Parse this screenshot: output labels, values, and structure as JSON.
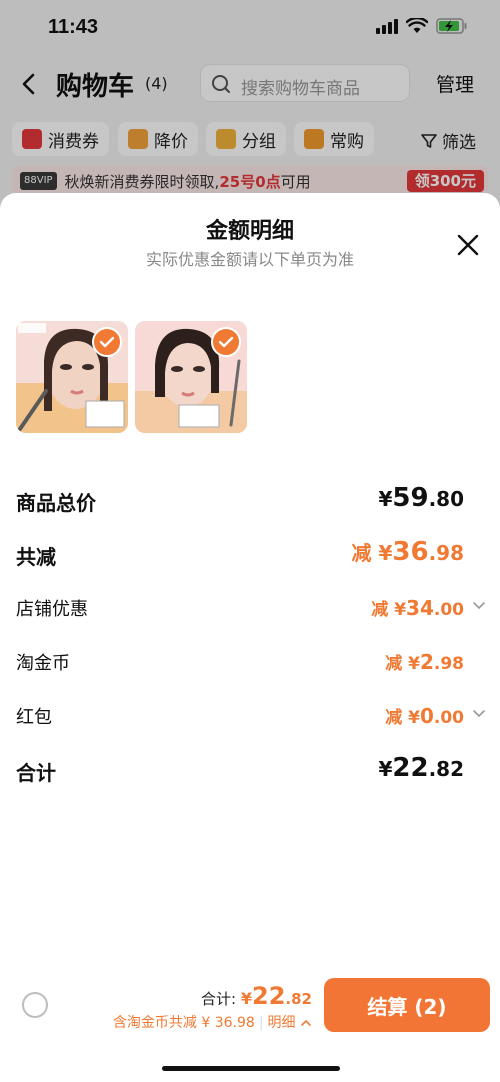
{
  "status": {
    "time": "11:43"
  },
  "header": {
    "title": "购物车",
    "count": "(4)",
    "search_placeholder": "搜索购物车商品",
    "manage": "管理"
  },
  "chips": [
    {
      "label": "消费券",
      "icon": "coupon-icon"
    },
    {
      "label": "降价",
      "icon": "price-drop-icon"
    },
    {
      "label": "分组",
      "icon": "folder-icon"
    },
    {
      "label": "常购",
      "icon": "cart-icon"
    }
  ],
  "filter_label": "筛选",
  "promo": {
    "vip": "88VIP",
    "text_prefix": "秋焕新消费券限时领取,",
    "text_highlight": "25号0点",
    "text_suffix": "可用",
    "button": "领300元"
  },
  "sheet": {
    "title": "金额明细",
    "subtitle": "实际优惠金额请以下单页为准",
    "rows": [
      {
        "label": "商品总价",
        "prefix": "",
        "yen": "¥",
        "int": "59",
        "dec": ".80"
      },
      {
        "label": "共减",
        "prefix": "减",
        "yen": "¥",
        "int": "36",
        "dec": ".98"
      },
      {
        "label": "店铺优惠",
        "prefix": "减",
        "yen": "¥",
        "int": "34",
        "dec": ".00"
      },
      {
        "label": "淘金币",
        "prefix": "减",
        "yen": "¥",
        "int": "2",
        "dec": ".98"
      },
      {
        "label": "红包",
        "prefix": "减",
        "yen": "¥",
        "int": "0",
        "dec": ".00"
      },
      {
        "label": "合计",
        "prefix": "",
        "yen": "¥",
        "int": "22",
        "dec": ".82"
      }
    ]
  },
  "bottom": {
    "total_label": "合计:",
    "yen": "¥",
    "total_int": "22",
    "total_dec": ".82",
    "discount_text": "含淘金币共减 ¥ 36.98",
    "detail_label": "明细",
    "checkout": "结算 (2)"
  },
  "colors": {
    "accent": "#f07a33",
    "promo_red": "#e4393c"
  }
}
